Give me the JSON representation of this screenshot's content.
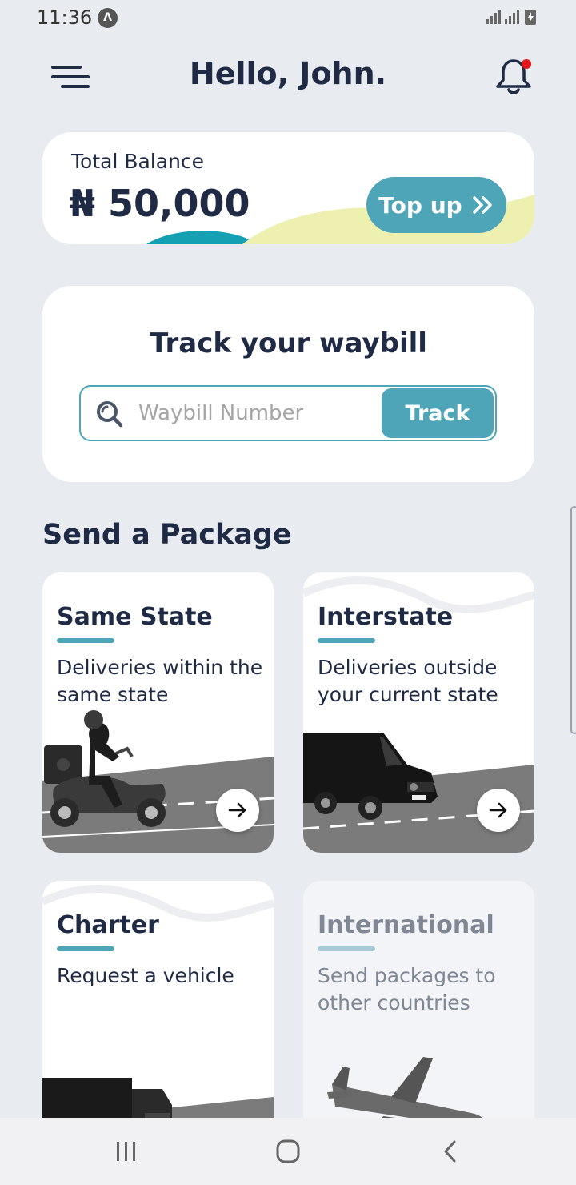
{
  "status_bar": {
    "time": "11:36",
    "app_badge": "Λ"
  },
  "header": {
    "greeting": "Hello, John."
  },
  "balance": {
    "label": "Total Balance",
    "amount": "₦ 50,000",
    "topup_label": "Top up",
    "topup_icon": "double-chevron-right-icon"
  },
  "track": {
    "title": "Track your waybill",
    "placeholder": "Waybill Number",
    "value": "",
    "button_label": "Track"
  },
  "section": {
    "title": "Send a Package"
  },
  "packages": [
    {
      "title": "Same State",
      "description": "Deliveries within the same state",
      "illustration": "scooter-rider"
    },
    {
      "title": "Interstate",
      "description": "Deliveries outside your current state",
      "illustration": "black-van"
    },
    {
      "title": "Charter",
      "description": "Request a vehicle",
      "illustration": "black-truck"
    },
    {
      "title": "International",
      "description": "Send packages to other countries",
      "illustration": "airplane",
      "disabled": true
    }
  ],
  "colors": {
    "accent": "#4fa5b8",
    "background": "#e8ebf0",
    "text": "#1f2a44",
    "notification_dot": "#e5141b",
    "wave_yellow": "#eef0b0"
  },
  "nav": {
    "icons": [
      "recents-icon",
      "home-icon",
      "back-icon"
    ]
  }
}
